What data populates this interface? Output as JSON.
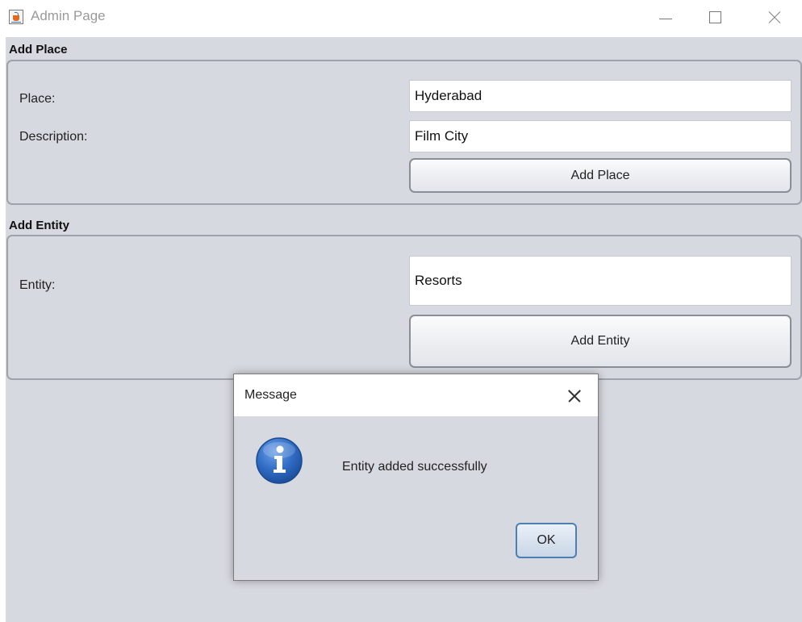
{
  "window": {
    "title": "Admin Page"
  },
  "add_place": {
    "section_title": "Add Place",
    "place_label": "Place:",
    "place_value": "Hyderabad",
    "description_label": "Description:",
    "description_value": "Film City",
    "button_label": "Add Place"
  },
  "add_entity": {
    "section_title": "Add Entity",
    "entity_label": "Entity:",
    "entity_value": "Resorts",
    "button_label": "Add Entity"
  },
  "dialog": {
    "title": "Message",
    "message": "Entity added successfully",
    "ok_label": "OK",
    "icon": "info-icon"
  },
  "colors": {
    "background": "#d7d9e0",
    "info_blue": "#2f6bc4",
    "ok_border": "#4d7fb5"
  }
}
